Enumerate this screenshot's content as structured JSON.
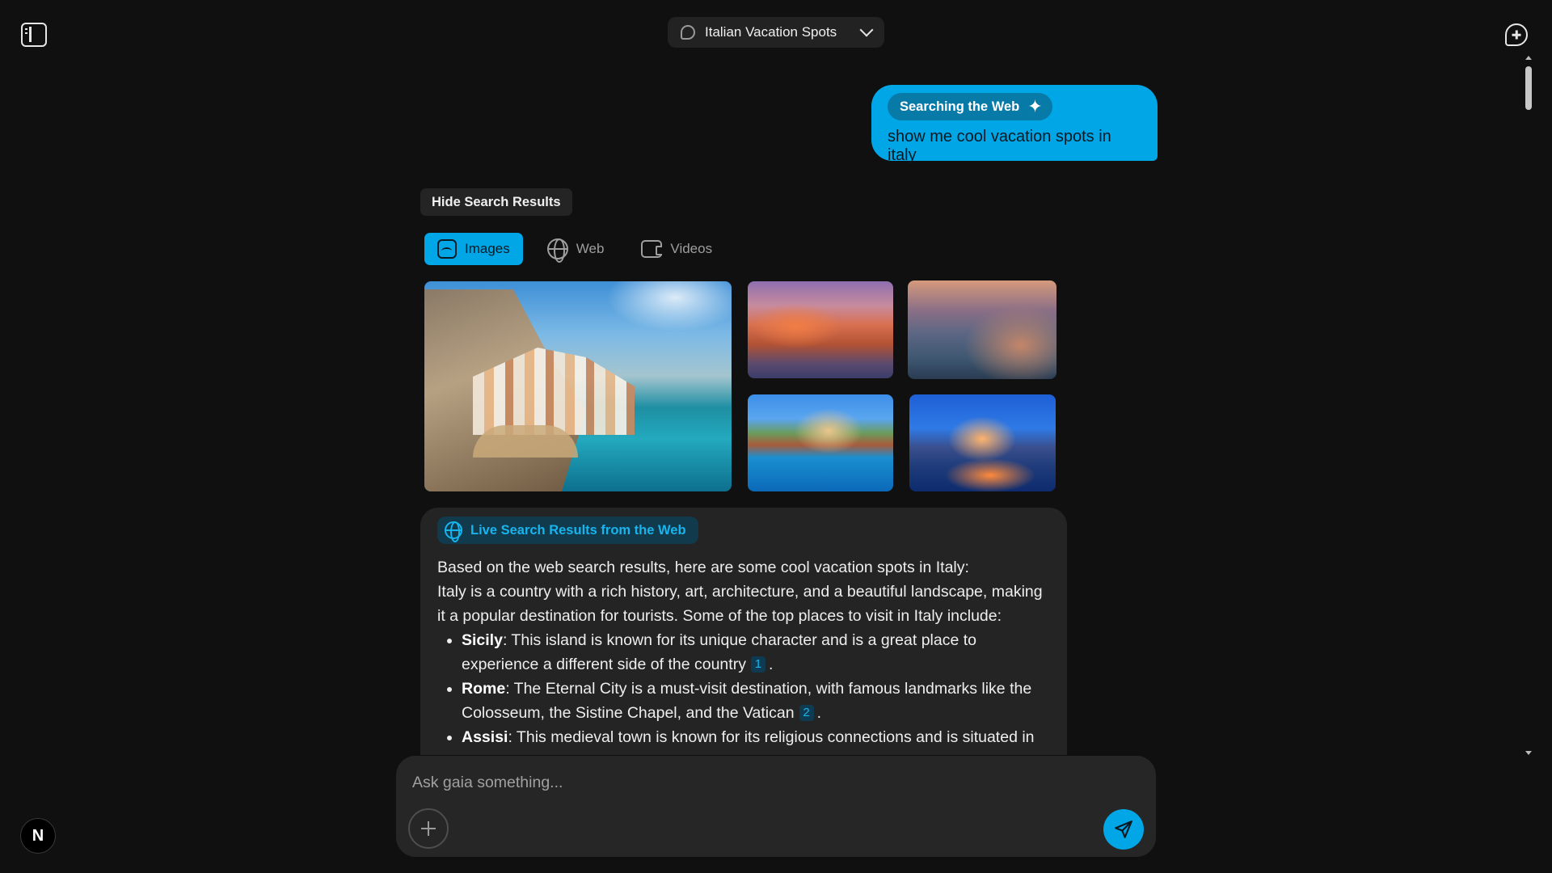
{
  "header": {
    "conversation_title": "Italian Vacation Spots"
  },
  "user_message": {
    "badge_label": "Searching the Web",
    "text": "show me cool vacation spots in italy"
  },
  "search_results": {
    "hide_label": "Hide Search Results",
    "tabs": [
      {
        "label": "Images",
        "icon": "image-icon",
        "active": true
      },
      {
        "label": "Web",
        "icon": "globe-icon",
        "active": false
      },
      {
        "label": "Videos",
        "icon": "video-icon",
        "active": false
      }
    ]
  },
  "answer": {
    "badge_label": "Live Search Results from the Web",
    "intro": "Based on the web search results, here are some cool vacation spots in Italy:",
    "paragraph": "Italy is a country with a rich history, art, architecture, and a beautiful landscape, making it a popular destination for tourists. Some of the top places to visit in Italy include:",
    "items": [
      {
        "name": "Sicily",
        "text": ": This island is known for its unique character and is a great place to experience a different side of the country",
        "cite": "1",
        "end": "."
      },
      {
        "name": "Rome",
        "text": ": The Eternal City is a must-visit destination, with famous landmarks like the Colosseum, the Sistine Chapel, and the Vatican",
        "cite": "2",
        "end": "."
      },
      {
        "name": "Assisi",
        "text": ": This medieval town is known for its religious connections and is situated in",
        "cite": "",
        "end": ""
      }
    ]
  },
  "input": {
    "placeholder": "Ask gaia something..."
  },
  "avatar": {
    "letter": "N"
  },
  "colors": {
    "accent": "#00a6e6",
    "background": "#101010",
    "card": "#242424"
  }
}
